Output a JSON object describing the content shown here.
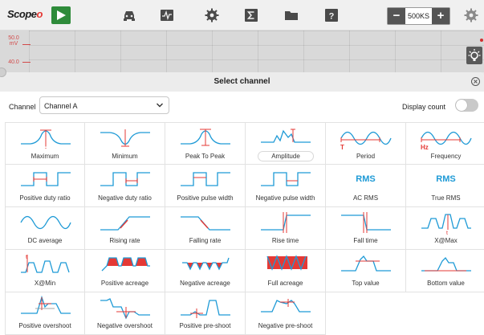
{
  "toolbar": {
    "logo_text": "Scope",
    "logo_accent": "o",
    "zoom_minus": "−",
    "zoom_value": "500KS",
    "zoom_plus": "+"
  },
  "scope": {
    "y_labels": [
      "50.0",
      "mV",
      "40.0"
    ]
  },
  "dialog": {
    "title": "Select channel",
    "channel_label": "Channel",
    "channel_value": "Channel A",
    "display_count_label": "Display count",
    "display_count_on": false
  },
  "colors": {
    "wave": "#1e9ad6",
    "marker": "#e53935",
    "play": "#2e8b3a"
  },
  "measurements": [
    {
      "label": "Maximum",
      "icon": "maximum-icon"
    },
    {
      "label": "Minimum",
      "icon": "minimum-icon"
    },
    {
      "label": "Peak To Peak",
      "icon": "peak-to-peak-icon"
    },
    {
      "label": "Amplitude",
      "icon": "amplitude-icon"
    },
    {
      "label": "Period",
      "icon": "period-icon"
    },
    {
      "label": "Frequency",
      "icon": "frequency-icon"
    },
    {
      "label": "Positive duty ratio",
      "icon": "positive-duty-ratio-icon"
    },
    {
      "label": "Negative duty ratio",
      "icon": "negative-duty-ratio-icon"
    },
    {
      "label": "Positive pulse width",
      "icon": "positive-pulse-width-icon"
    },
    {
      "label": "Negative pulse width",
      "icon": "negative-pulse-width-icon"
    },
    {
      "label": "AC RMS",
      "icon": "rms-icon",
      "text": "RMS"
    },
    {
      "label": "True RMS",
      "icon": "rms-icon",
      "text": "RMS"
    },
    {
      "label": "DC average",
      "icon": "dc-average-icon"
    },
    {
      "label": "Rising rate",
      "icon": "rising-rate-icon"
    },
    {
      "label": "Falling rate",
      "icon": "falling-rate-icon"
    },
    {
      "label": "Rise time",
      "icon": "rise-time-icon"
    },
    {
      "label": "Fall time",
      "icon": "fall-time-icon"
    },
    {
      "label": "X@Max",
      "icon": "x-at-max-icon"
    },
    {
      "label": "X@Min",
      "icon": "x-at-min-icon"
    },
    {
      "label": "Positive acreage",
      "icon": "positive-acreage-icon"
    },
    {
      "label": "Negative acreage",
      "icon": "negative-acreage-icon"
    },
    {
      "label": "Full acreage",
      "icon": "full-acreage-icon"
    },
    {
      "label": "Top value",
      "icon": "top-value-icon"
    },
    {
      "label": "Bottom value",
      "icon": "bottom-value-icon"
    },
    {
      "label": "Positive overshoot",
      "icon": "positive-overshoot-icon"
    },
    {
      "label": "Negative overshoot",
      "icon": "negative-overshoot-icon"
    },
    {
      "label": "Positive pre-shoot",
      "icon": "positive-pre-shoot-icon"
    },
    {
      "label": "Negative pre-shoot",
      "icon": "negative-pre-shoot-icon"
    }
  ]
}
